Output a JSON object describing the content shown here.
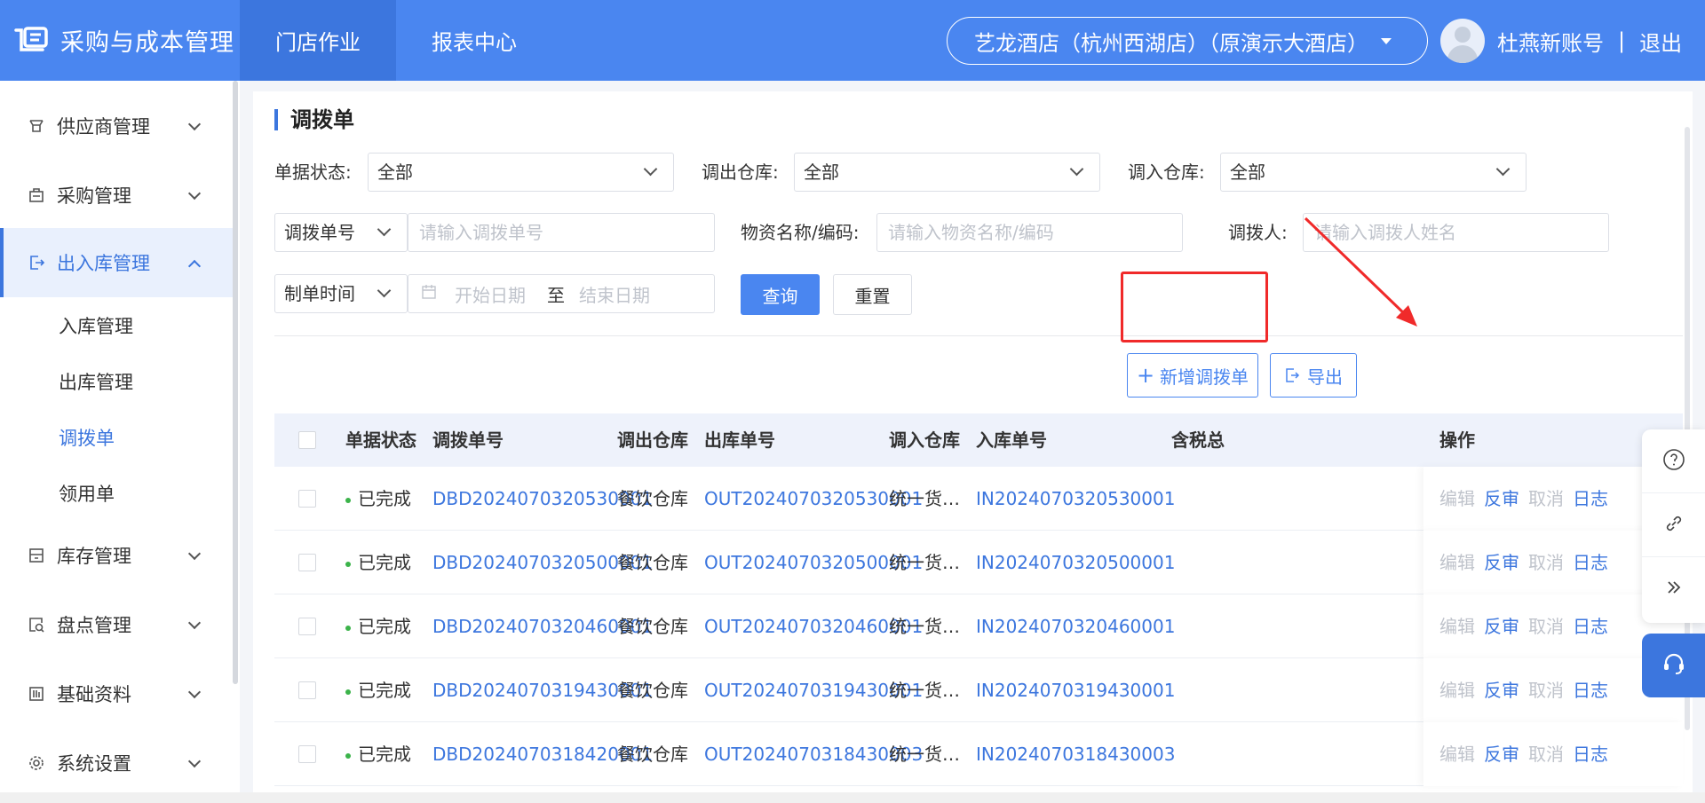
{
  "app": {
    "title": "采购与成本管理"
  },
  "header": {
    "nav": [
      {
        "label": "门店作业",
        "active": true
      },
      {
        "label": "报表中心",
        "active": false
      }
    ],
    "store": "艺龙酒店（杭州西湖店）（原演示大酒店）",
    "user": "杜燕新账号",
    "separator": "|",
    "logout": "退出"
  },
  "sidebar": {
    "items": [
      {
        "label": "供应商管理",
        "icon": "supplier-icon"
      },
      {
        "label": "采购管理",
        "icon": "purchase-icon"
      },
      {
        "label": "出入库管理",
        "icon": "inout-icon",
        "active": true
      },
      {
        "label": "库存管理",
        "icon": "inventory-icon"
      },
      {
        "label": "盘点管理",
        "icon": "stocktake-icon"
      },
      {
        "label": "基础资料",
        "icon": "basic-data-icon"
      },
      {
        "label": "系统设置",
        "icon": "settings-icon"
      }
    ],
    "sub_items": [
      {
        "label": "入库管理"
      },
      {
        "label": "出库管理"
      },
      {
        "label": "调拨单",
        "active": true
      },
      {
        "label": "领用单"
      }
    ]
  },
  "page": {
    "title": "调拨单"
  },
  "filters": {
    "status_label": "单据状态:",
    "status_value": "全部",
    "out_wh_label": "调出仓库:",
    "out_wh_value": "全部",
    "in_wh_label": "调入仓库:",
    "in_wh_value": "全部",
    "number_type": "调拨单号",
    "number_placeholder": "请输入调拨单号",
    "material_label": "物资名称/编码:",
    "material_placeholder": "请输入物资名称/编码",
    "person_label": "调拨人:",
    "person_placeholder": "请输入调拨人姓名",
    "time_type": "制单时间",
    "start_placeholder": "开始日期",
    "to": "至",
    "end_placeholder": "结束日期",
    "query": "查询",
    "reset": "重置"
  },
  "actions": {
    "add": "新增调拨单",
    "export": "导出"
  },
  "table": {
    "headers": [
      "单据状态",
      "调拨单号",
      "调出仓库",
      "出库单号",
      "调入仓库",
      "入库单号",
      "含税总",
      "操作"
    ],
    "ops": [
      "编辑",
      "反审",
      "取消",
      "日志"
    ],
    "rows": [
      {
        "status": "已完成",
        "number": "DBD2024070320530001",
        "out_wh": "餐饮仓库",
        "out_no": "OUT2024070320530001",
        "in_wh": "统一货…",
        "in_no": "IN2024070320530001"
      },
      {
        "status": "已完成",
        "number": "DBD2024070320500001",
        "out_wh": "餐饮仓库",
        "out_no": "OUT2024070320500001",
        "in_wh": "统一货…",
        "in_no": "IN2024070320500001"
      },
      {
        "status": "已完成",
        "number": "DBD2024070320460001",
        "out_wh": "餐饮仓库",
        "out_no": "OUT2024070320460001",
        "in_wh": "统一货…",
        "in_no": "IN2024070320460001"
      },
      {
        "status": "已完成",
        "number": "DBD2024070319430001",
        "out_wh": "餐饮仓库",
        "out_no": "OUT2024070319430001",
        "in_wh": "统一货…",
        "in_no": "IN2024070319430001"
      },
      {
        "status": "已完成",
        "number": "DBD2024070318420001",
        "out_wh": "餐饮仓库",
        "out_no": "OUT2024070318430003",
        "in_wh": "统一货…",
        "in_no": "IN2024070318430003"
      }
    ]
  },
  "colors": {
    "primary": "#4a86f0",
    "primary_dark": "#3c76de",
    "status_done": "#3bb34a",
    "highlight": "#f02a2a"
  },
  "float_tools": [
    "help-icon",
    "link-icon",
    "collapse-icon",
    "customer-service-icon"
  ]
}
